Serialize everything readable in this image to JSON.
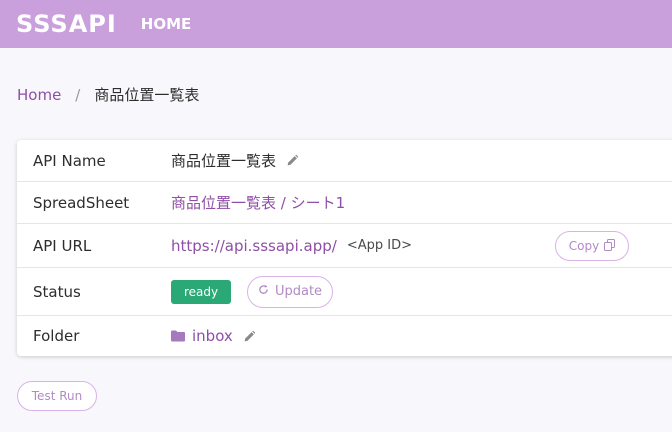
{
  "header": {
    "logo": "SSSAPI",
    "nav_home": "HOME"
  },
  "breadcrumb": {
    "home": "Home",
    "separator": "/",
    "current": "商品位置一覧表"
  },
  "details": {
    "api_name": {
      "label": "API Name",
      "value": "商品位置一覧表"
    },
    "spreadsheet": {
      "label": "SpreadSheet",
      "value": "商品位置一覧表 / シート1"
    },
    "api_url": {
      "label": "API URL",
      "url": "https://api.sssapi.app/",
      "suffix": "<App ID>",
      "copy_label": "Copy"
    },
    "status": {
      "label": "Status",
      "badge": "ready",
      "update_label": "Update"
    },
    "folder": {
      "label": "Folder",
      "value": "inbox"
    }
  },
  "actions": {
    "test_run": "Test Run"
  },
  "colors": {
    "header_bg": "#c9a0dc",
    "accent": "#8e4fa6",
    "status_ready": "#2aa876",
    "button_border": "#d9b3e6"
  }
}
